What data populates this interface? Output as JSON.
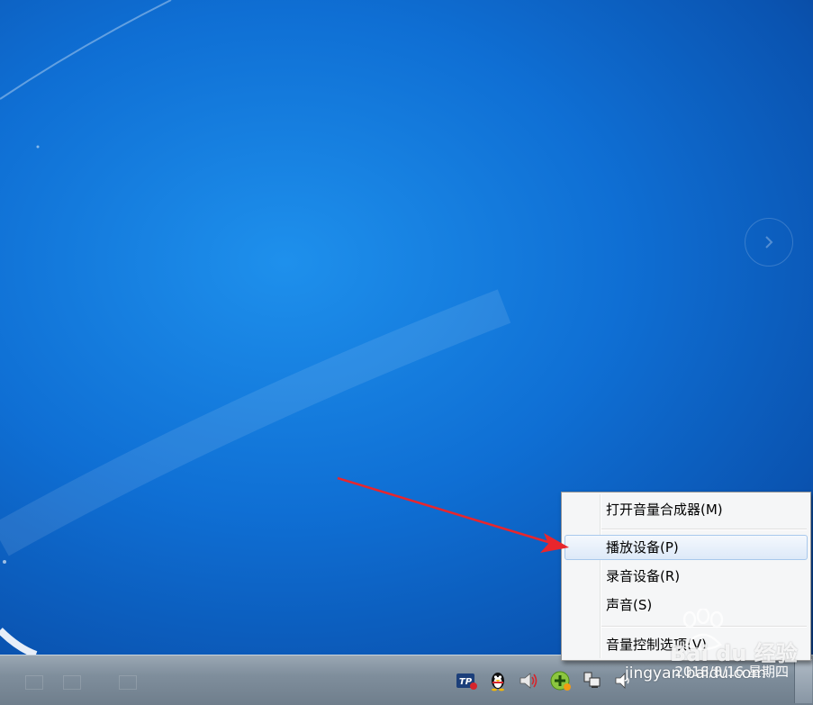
{
  "context_menu": {
    "items": [
      {
        "label": "打开音量合成器(M)"
      },
      {
        "label": "播放设备(P)"
      },
      {
        "label": "录音设备(R)"
      },
      {
        "label": "声音(S)"
      },
      {
        "label": "音量控制选项(V)"
      }
    ],
    "highlighted_index": 1
  },
  "taskbar": {
    "clock": {
      "time": "",
      "date": "2018/8/16 星期四"
    },
    "tray_icons": [
      "tp-link-icon",
      "qq-penguin-icon",
      "speaker-icon",
      "security-plus-icon",
      "network-icon",
      "volume-icon"
    ]
  },
  "watermark": {
    "brand": "Bai du 经验",
    "url": "jingyan.baidu.com"
  },
  "colors": {
    "desktop": "#0f6fd4",
    "taskbar": "#7f8e9c",
    "menu_bg": "#f5f6f7",
    "menu_hover": "#dde9f8",
    "arrow": "#e8262d"
  }
}
